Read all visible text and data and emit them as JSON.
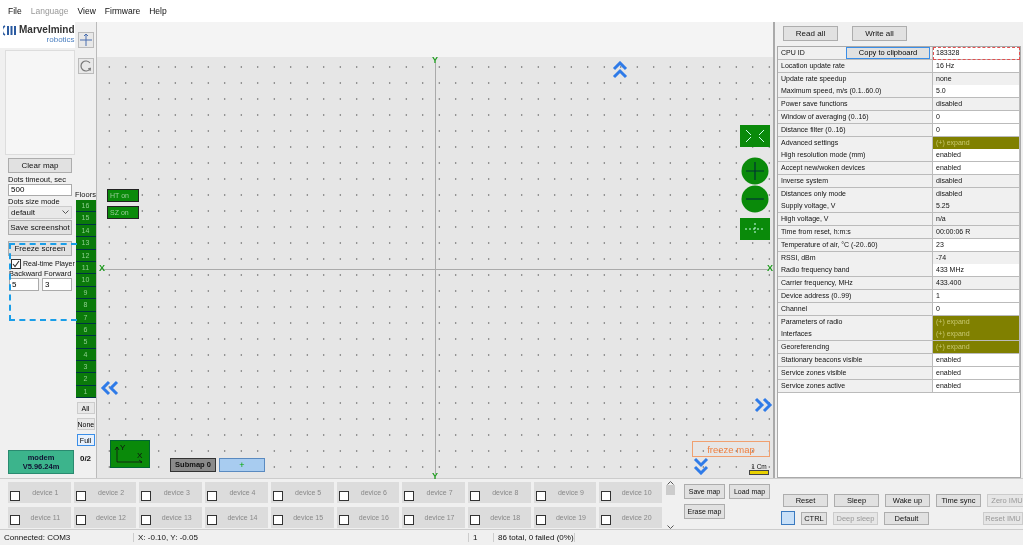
{
  "menu": [
    {
      "label": "File",
      "disabled": false
    },
    {
      "label": "Language",
      "disabled": true
    },
    {
      "label": "View",
      "disabled": false
    },
    {
      "label": "Firmware",
      "disabled": false
    },
    {
      "label": "Help",
      "disabled": false
    }
  ],
  "logo": {
    "name": "Marvelmind",
    "tagline": "robotics"
  },
  "left_panel": {
    "clear_map": "Clear map",
    "dots_timeout": {
      "label": "Dots timeout, sec",
      "value": "500"
    },
    "dots_size": {
      "label": "Dots size mode",
      "value": "default"
    },
    "save_screenshot": "Save screenshot",
    "freeze_screen": "Freeze screen",
    "realtime_player": {
      "label": "Real-time Player",
      "checked": true
    },
    "backward": {
      "label": "Backward",
      "value": "5"
    },
    "forward": {
      "label": "Forward",
      "value": "3"
    },
    "modem": {
      "name": "modem",
      "version": "V5.96.24m"
    }
  },
  "floors": {
    "label": "Floors",
    "items": [
      "16",
      "15",
      "14",
      "13",
      "12",
      "11",
      "10",
      "9",
      "8",
      "7",
      "6",
      "5",
      "4",
      "3",
      "2",
      "1"
    ],
    "count": "0/2",
    "filters": [
      {
        "label": "All",
        "selected": false
      },
      {
        "label": "None",
        "selected": false
      },
      {
        "label": "Full",
        "selected": true
      }
    ]
  },
  "map": {
    "y_top": "Y",
    "y_bottom": "Y",
    "x_left": "X",
    "x_right": "X",
    "badges": [
      "HT on",
      "SZ on"
    ],
    "axes_button": {
      "y": "Y",
      "x": "X"
    },
    "submap": "Submap 0",
    "add": "+",
    "freeze": "freeze map",
    "scale": "1 Cm"
  },
  "settings": {
    "buttons": [
      "Read all",
      "Write all"
    ],
    "copy_button": "Copy to clipboard",
    "rows": [
      {
        "label": "CPU ID",
        "value": "183328",
        "kind": "id",
        "readonly": false
      },
      {
        "label": "Location update rate",
        "value": "16 Hz",
        "kind": "text",
        "readonly": false
      },
      {
        "label": "Update rate speedup",
        "value": "none",
        "kind": "text",
        "readonly": true
      },
      {
        "label": "Maximum speed, m/s (0.1..60.0)",
        "value": "5.0",
        "kind": "text",
        "readonly": false
      },
      {
        "label": "Power save functions",
        "value": "disabled",
        "kind": "text",
        "readonly": true
      },
      {
        "label": "Window of averaging (0..16)",
        "value": "0",
        "kind": "text",
        "readonly": false
      },
      {
        "label": "Distance filter (0..16)",
        "value": "0",
        "kind": "text",
        "readonly": false
      },
      {
        "label": "Advanced settings",
        "value": "(+) expand",
        "kind": "expand"
      },
      {
        "label": "High resolution mode (mm)",
        "value": "enabled",
        "kind": "text",
        "readonly": false
      },
      {
        "label": "Accept new/woken devices",
        "value": "enabled",
        "kind": "text",
        "readonly": false
      },
      {
        "label": "Inverse system",
        "value": "disabled",
        "kind": "text",
        "readonly": true
      },
      {
        "label": "Distances only mode",
        "value": "disabled",
        "kind": "text",
        "readonly": true
      },
      {
        "label": "Supply voltage, V",
        "value": "5.25",
        "kind": "text",
        "readonly": true
      },
      {
        "label": "High voltage, V",
        "value": "n/a",
        "kind": "text",
        "readonly": true
      },
      {
        "label": "Time from reset, h:m:s",
        "value": "00:00:06   R",
        "kind": "text",
        "readonly": true
      },
      {
        "label": "Temperature of air, °C (-20..60)",
        "value": "23",
        "kind": "text",
        "readonly": false
      },
      {
        "label": "RSSI, dBm",
        "value": "-74",
        "kind": "text",
        "readonly": true
      },
      {
        "label": "Radio frequency band",
        "value": "433 MHz",
        "kind": "text",
        "readonly": false
      },
      {
        "label": "Carrier frequency, MHz",
        "value": "433.400",
        "kind": "text",
        "readonly": true
      },
      {
        "label": "Device address (0..99)",
        "value": "1",
        "kind": "text",
        "readonly": false
      },
      {
        "label": "Channel",
        "value": "0",
        "kind": "text",
        "readonly": false
      },
      {
        "label": "Parameters of radio",
        "value": "(+) expand",
        "kind": "expand"
      },
      {
        "label": "Interfaces",
        "value": "(+) expand",
        "kind": "expand"
      },
      {
        "label": "Georeferencing",
        "value": "(+) expand",
        "kind": "expand"
      },
      {
        "label": "Stationary beacons visible",
        "value": "enabled",
        "kind": "text",
        "readonly": false
      },
      {
        "label": "Service zones visible",
        "value": "enabled",
        "kind": "text",
        "readonly": false
      },
      {
        "label": "Service zones active",
        "value": "enabled",
        "kind": "text",
        "readonly": false
      }
    ]
  },
  "devices": [
    {
      "label": "device 1",
      "checked": false
    },
    {
      "label": "device 2",
      "checked": false
    },
    {
      "label": "device 3",
      "checked": false
    },
    {
      "label": "device 4",
      "checked": false
    },
    {
      "label": "device 5",
      "checked": false
    },
    {
      "label": "device 6",
      "checked": false
    },
    {
      "label": "device 7",
      "checked": false
    },
    {
      "label": "device 8",
      "checked": false
    },
    {
      "label": "device 9",
      "checked": false
    },
    {
      "label": "device 10",
      "checked": false
    },
    {
      "label": "device 11",
      "checked": false
    },
    {
      "label": "device 12",
      "checked": false
    },
    {
      "label": "device 13",
      "checked": false
    },
    {
      "label": "device 14",
      "checked": false
    },
    {
      "label": "device 15",
      "checked": false
    },
    {
      "label": "device 16",
      "checked": false
    },
    {
      "label": "device 17",
      "checked": false
    },
    {
      "label": "device 18",
      "checked": false
    },
    {
      "label": "device 19",
      "checked": false
    },
    {
      "label": "device 20",
      "checked": false
    }
  ],
  "map_buttons": [
    "Save map",
    "Load map",
    "Erase map"
  ],
  "control_rows": [
    [
      {
        "label": "Reset",
        "kind": "button",
        "disabled": false
      },
      {
        "label": "Sleep",
        "kind": "button",
        "disabled": false
      },
      {
        "label": "Wake up",
        "kind": "button",
        "disabled": false
      },
      {
        "label": "Time sync",
        "kind": "button",
        "disabled": false
      },
      {
        "label": "Zero IMU",
        "kind": "button",
        "disabled": true
      }
    ],
    [
      {
        "label": "CTRL",
        "kind": "ctrl"
      },
      {
        "label": "Deep sleep",
        "kind": "button",
        "disabled": true
      },
      {
        "label": "Default",
        "kind": "button",
        "disabled": false
      },
      {
        "label": "Reset IMU",
        "kind": "button",
        "disabled": true
      }
    ]
  ],
  "status_bar": [
    "Connected: COM3",
    "X: -0.10, Y: -0.05",
    "1",
    "86 total, 0 failed (0%)"
  ]
}
